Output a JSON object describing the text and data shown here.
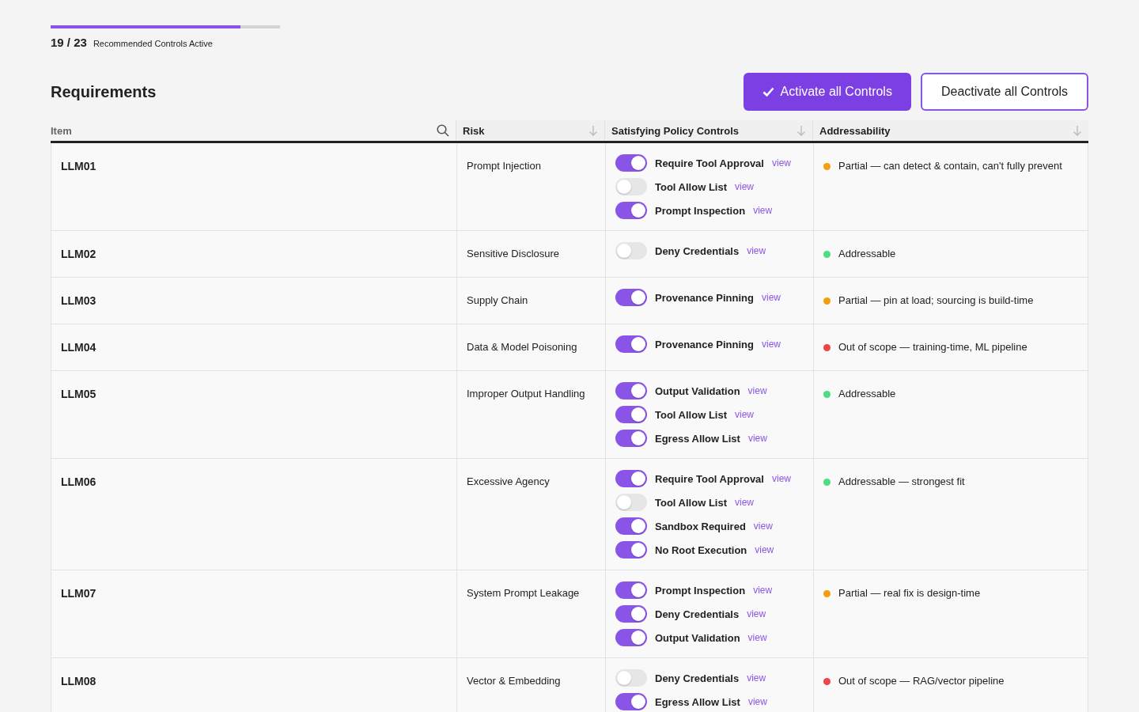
{
  "progress": {
    "level": 0.826,
    "count": "19 / 23",
    "label": "Recommended Controls Active"
  },
  "title": "Requirements",
  "buttons": [
    {
      "kind": "primary",
      "label": "Activate all Controls"
    },
    {
      "kind": "secondary",
      "label": "Deactivate all Controls"
    }
  ],
  "table": {
    "columns": [
      {
        "label": "Item",
        "kind": "search"
      },
      {
        "label": "Risk",
        "kind": "sort"
      },
      {
        "label": "Satisfying Policy Controls",
        "kind": "sort"
      },
      {
        "label": "Addressability",
        "kind": "sort"
      }
    ],
    "rows": [
      {
        "item": "LLM01",
        "risk": "Prompt Injection",
        "controls": [
          {
            "name": "Require Tool Approval",
            "on": true,
            "link": "view"
          },
          {
            "name": "Tool Allow List",
            "on": false,
            "link": "view"
          },
          {
            "name": "Prompt Inspection",
            "on": true,
            "link": "view"
          }
        ],
        "addressability": {
          "text": "Partial — can detect & contain, can't fully prevent",
          "color": "#f59e0b"
        }
      },
      {
        "item": "LLM02",
        "risk": "Sensitive Disclosure",
        "controls": [
          {
            "name": "Deny Credentials",
            "on": false,
            "link": "view"
          }
        ],
        "addressability": {
          "text": "Addressable",
          "color": "#4ade80"
        }
      },
      {
        "item": "LLM03",
        "risk": "Supply Chain",
        "controls": [
          {
            "name": "Provenance Pinning",
            "on": true,
            "link": "view"
          }
        ],
        "addressability": {
          "text": "Partial — pin at load; sourcing is build-time",
          "color": "#f59e0b"
        }
      },
      {
        "item": "LLM04",
        "risk": "Data & Model Poisoning",
        "controls": [
          {
            "name": "Provenance Pinning",
            "on": true,
            "link": "view"
          }
        ],
        "addressability": {
          "text": "Out of scope — training-time, ML pipeline",
          "color": "#ef4444"
        }
      },
      {
        "item": "LLM05",
        "risk": "Improper Output Handling",
        "controls": [
          {
            "name": "Output Validation",
            "on": true,
            "link": "view"
          },
          {
            "name": "Tool Allow List",
            "on": true,
            "link": "view"
          },
          {
            "name": "Egress Allow List",
            "on": true,
            "link": "view"
          }
        ],
        "addressability": {
          "text": "Addressable",
          "color": "#4ade80"
        }
      },
      {
        "item": "LLM06",
        "risk": "Excessive Agency",
        "controls": [
          {
            "name": "Require Tool Approval",
            "on": true,
            "link": "view"
          },
          {
            "name": "Tool Allow List",
            "on": false,
            "link": "view"
          },
          {
            "name": "Sandbox Required",
            "on": true,
            "link": "view"
          },
          {
            "name": "No Root Execution",
            "on": true,
            "link": "view"
          }
        ],
        "addressability": {
          "text": "Addressable — strongest fit",
          "color": "#4ade80"
        }
      },
      {
        "item": "LLM07",
        "risk": "System Prompt Leakage",
        "controls": [
          {
            "name": "Prompt Inspection",
            "on": true,
            "link": "view"
          },
          {
            "name": "Deny Credentials",
            "on": true,
            "link": "view"
          },
          {
            "name": "Output Validation",
            "on": true,
            "link": "view"
          }
        ],
        "addressability": {
          "text": "Partial — real fix is design-time",
          "color": "#f59e0b"
        }
      },
      {
        "item": "LLM08",
        "risk": "Vector & Embedding",
        "controls": [
          {
            "name": "Deny Credentials",
            "on": false,
            "link": "view"
          },
          {
            "name": "Egress Allow List",
            "on": true,
            "link": "view"
          }
        ],
        "addressability": {
          "text": "Out of scope — RAG/vector pipeline",
          "color": "#ef4444"
        }
      }
    ]
  }
}
